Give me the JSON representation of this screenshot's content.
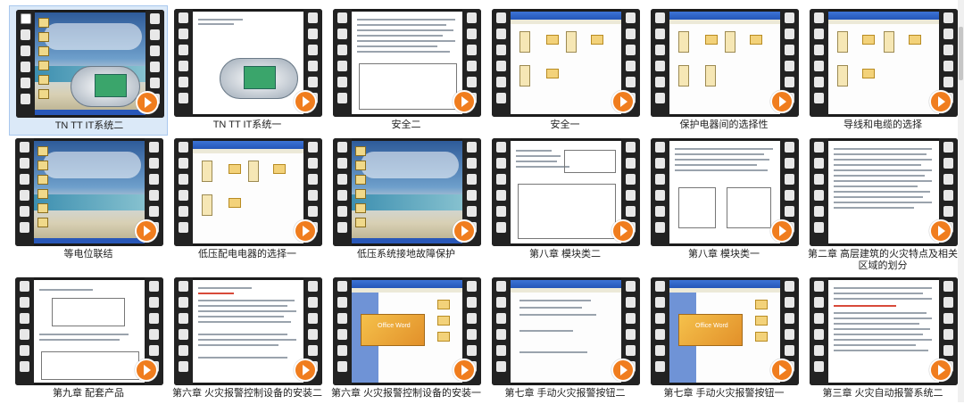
{
  "files": [
    {
      "label": "TN TT IT系统二",
      "thumb": "desktop-device"
    },
    {
      "label": "TN TT IT系统一",
      "thumb": "device"
    },
    {
      "label": "安全二",
      "thumb": "document-table"
    },
    {
      "label": "安全一",
      "thumb": "explorer-folders"
    },
    {
      "label": "保护电器间的选择性",
      "thumb": "explorer-folders"
    },
    {
      "label": "导线和电缆的选择",
      "thumb": "explorer-folders"
    },
    {
      "label": "等电位联结",
      "thumb": "desktop"
    },
    {
      "label": "低压配电电器的选择一",
      "thumb": "explorer-folders"
    },
    {
      "label": "低压系统接地故障保护",
      "thumb": "desktop"
    },
    {
      "label": "第八章  模块类二",
      "thumb": "document-table"
    },
    {
      "label": "第八章  模块类一",
      "thumb": "document-drawing"
    },
    {
      "label": "第二章  高层建筑的火灾特点及相关区域的划分",
      "thumb": "document-text"
    },
    {
      "label": "第九章   配套产品",
      "thumb": "document-drawing"
    },
    {
      "label": "第六章  火灾报警控制设备的安装二",
      "thumb": "document-text-red"
    },
    {
      "label": "第六章  火灾报警控制设备的安装一",
      "thumb": "word-explorer"
    },
    {
      "label": "第七章  手动火灾报警按钮二",
      "thumb": "word-document"
    },
    {
      "label": "第七章  手动火灾报警按钮一",
      "thumb": "word-explorer"
    },
    {
      "label": "第三章  火灾自动报警系统二",
      "thumb": "document-text-red"
    }
  ],
  "colors": {
    "play_button": "#f07d1e",
    "selection": "#dbe9f8"
  }
}
